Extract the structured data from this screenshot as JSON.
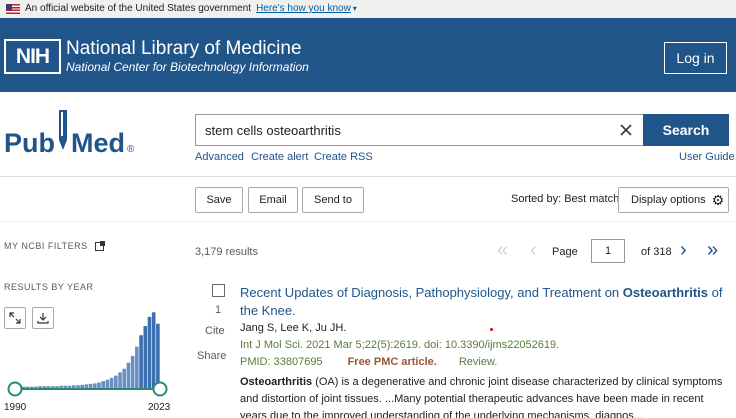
{
  "banner": {
    "text": "An official website of the United States government",
    "link": "Here's how you know"
  },
  "header": {
    "logo_text": "NIH",
    "title": "National Library of Medicine",
    "subtitle": "National Center for Biotechnology Information",
    "login_label": "Log in"
  },
  "pubmed": {
    "logo_left": "Pub",
    "logo_right": "Med",
    "registered": "®"
  },
  "search": {
    "value": "stem cells osteoarthritis",
    "button_label": "Search",
    "links": [
      "Advanced",
      "Create alert",
      "Create RSS"
    ],
    "user_guide": "User Guide"
  },
  "actions": {
    "save": "Save",
    "email": "Email",
    "send_to": "Send to",
    "sorted_by": "Sorted by: Best match",
    "display_options": "Display options"
  },
  "sidebar": {
    "filters_label": "MY NCBI FILTERS",
    "results_by_year": "RESULTS BY YEAR",
    "year_start": "1990",
    "year_end": "2023"
  },
  "chart_data": {
    "type": "bar",
    "title": "",
    "x": [
      "1990",
      "1991",
      "1992",
      "1993",
      "1994",
      "1995",
      "1996",
      "1997",
      "1998",
      "1999",
      "2000",
      "2001",
      "2002",
      "2003",
      "2004",
      "2005",
      "2006",
      "2007",
      "2008",
      "2009",
      "2010",
      "2011",
      "2012",
      "2013",
      "2014",
      "2015",
      "2016",
      "2017",
      "2018",
      "2019",
      "2020",
      "2021",
      "2022",
      "2023"
    ],
    "values": [
      3,
      3,
      3,
      3,
      3,
      4,
      4,
      4,
      4,
      4,
      5,
      5,
      5,
      6,
      6,
      7,
      8,
      9,
      10,
      12,
      15,
      18,
      22,
      27,
      34,
      42,
      55,
      70,
      90,
      115,
      135,
      155,
      165,
      140
    ],
    "highlight_from": "2019",
    "ylim": [
      0,
      170
    ]
  },
  "results": {
    "count": "3,179 results",
    "page_label": "Page",
    "page_value": "1",
    "page_of": "of 318",
    "items": [
      {
        "number": "1",
        "cite": "Cite",
        "share": "Share",
        "title_pre": "Recent Updates of Diagnosis, Pathophysiology, and Treatment on ",
        "title_hl": "Osteoarthritis",
        "title_post": " of the Knee.",
        "authors": "Jang S, Lee K, Ju JH.",
        "journal": "Int J Mol Sci. 2021 Mar 5;22(5):2619. doi: 10.3390/ijms22052619.",
        "pmid": "PMID: 33807695",
        "free": "Free PMC article.",
        "type": "Review.",
        "snippet_hl": "Osteoarthritis",
        "snippet": " (OA) is a degenerative and chronic joint disease characterized by clinical symptoms and distortion of joint tissues. ...Many potential therapeutic advances have been made in recent years due to the improved understanding of the underlying mechanisms, diagnos..."
      }
    ]
  },
  "colors": {
    "brand": "#20558a",
    "bar": "#6a8fc4",
    "bar_highlight": "#3a6fb0",
    "free": "#985735",
    "journal": "#5a7a3a"
  }
}
